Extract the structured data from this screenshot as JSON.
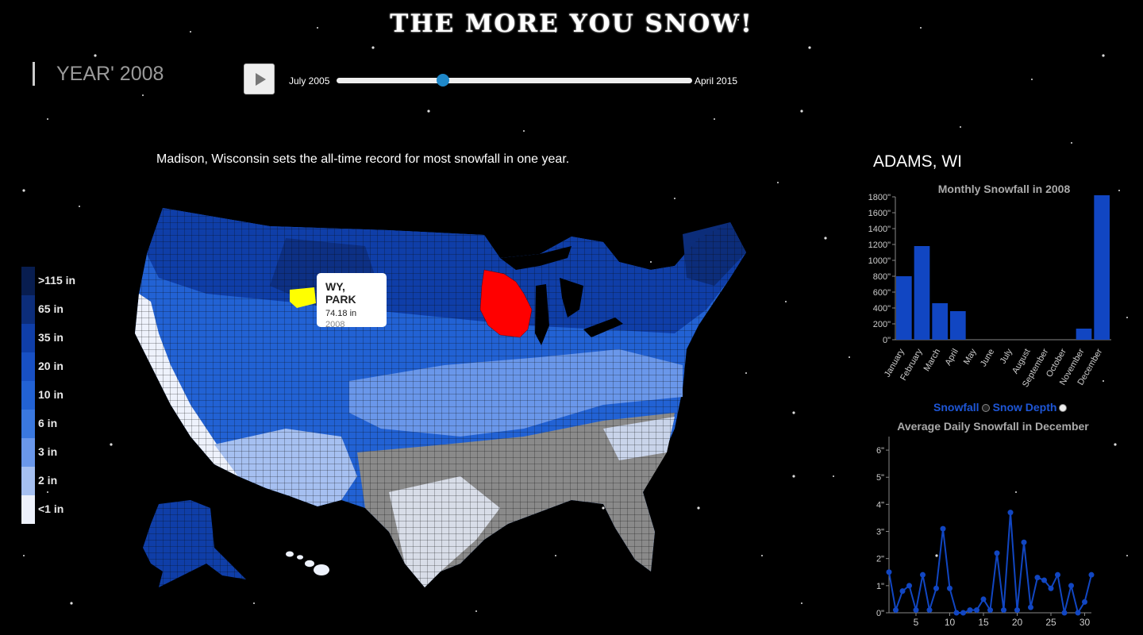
{
  "title": "THE MORE YOU SNOW!",
  "year_label": "YEAR' 2008",
  "slider": {
    "start_label": "July 2005",
    "end_label": "April 2015",
    "position": 0.3
  },
  "headline": "Madison, Wisconsin sets the all-time record for most snowfall in one year.",
  "legend": [
    {
      "label": ">115 in",
      "color": "#081d4f"
    },
    {
      "label": "65 in",
      "color": "#0c2d7a"
    },
    {
      "label": "35 in",
      "color": "#0f3ea8"
    },
    {
      "label": "20 in",
      "color": "#1850c4"
    },
    {
      "label": "10 in",
      "color": "#2262d4"
    },
    {
      "label": "6 in",
      "color": "#3a78df"
    },
    {
      "label": "3 in",
      "color": "#6a97ea"
    },
    {
      "label": "2 in",
      "color": "#a6c0f1"
    },
    {
      "label": "<1 in",
      "color": "#eef2fc"
    }
  ],
  "tooltip": {
    "name": "WY, PARK",
    "value": "74.18 in",
    "year": "2008"
  },
  "highlights": {
    "selected_state": "Wisconsin",
    "selected_color": "#ff0000",
    "hover_county": "WY, PARK",
    "hover_color": "#ffff00"
  },
  "county_title": "ADAMS, WI",
  "toggle": {
    "option1": "Snowfall",
    "option2": "Snow Depth",
    "accent": "#1e56d6"
  },
  "chart_data": [
    {
      "type": "bar",
      "title": "Monthly Snowfall in 2008",
      "categories": [
        "January",
        "February",
        "March",
        "April",
        "May",
        "June",
        "July",
        "August",
        "September",
        "October",
        "November",
        "December"
      ],
      "values": [
        800,
        1180,
        460,
        360,
        0,
        0,
        0,
        0,
        0,
        0,
        140,
        1820
      ],
      "yticks": [
        "0\"",
        "200\"",
        "400\"",
        "600\"",
        "800\"",
        "1000\"",
        "1200\"",
        "1400\"",
        "1600\"",
        "1800\""
      ],
      "ylim": [
        0,
        1800
      ],
      "color": "#1146c2"
    },
    {
      "type": "line",
      "title": "Average Daily Snowfall in December",
      "x": [
        1,
        2,
        3,
        4,
        5,
        6,
        7,
        8,
        9,
        10,
        11,
        12,
        13,
        14,
        15,
        16,
        17,
        18,
        19,
        20,
        21,
        22,
        23,
        24,
        25,
        26,
        27,
        28,
        29,
        30,
        31
      ],
      "values": [
        1.5,
        0.1,
        0.8,
        1.0,
        0.1,
        1.4,
        0.1,
        0.9,
        3.1,
        0.9,
        0.0,
        0.0,
        0.1,
        0.1,
        0.5,
        0.1,
        2.2,
        0.1,
        3.7,
        0.1,
        2.6,
        0.2,
        1.3,
        1.2,
        0.9,
        1.4,
        0.0,
        1.0,
        0.0,
        0.4,
        1.4
      ],
      "xticks": [
        "5",
        "10",
        "15",
        "20",
        "25",
        "30"
      ],
      "yticks": [
        "0\"",
        "1\"",
        "2\"",
        "3\"",
        "4\"",
        "5\"",
        "6\""
      ],
      "ylim": [
        0,
        6.5
      ],
      "color": "#1146c2"
    }
  ]
}
